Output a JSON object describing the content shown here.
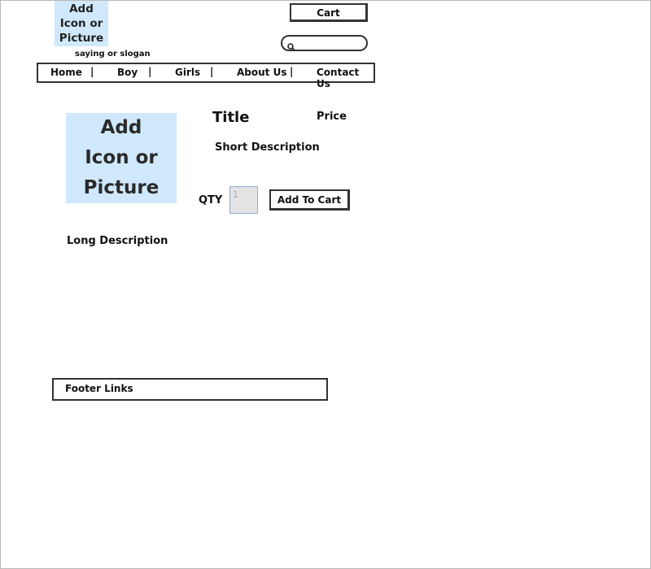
{
  "header": {
    "logo_lines": [
      "Add",
      "Icon or",
      "Picture"
    ],
    "slogan": "saying or slogan",
    "cart_label": "Cart",
    "search_placeholder": ""
  },
  "nav": {
    "items": [
      "Home",
      "Boy",
      "Girls",
      "About Us",
      "Contact Us"
    ],
    "separator": "|"
  },
  "product": {
    "image_lines": [
      "Add",
      "Icon or",
      "Picture"
    ],
    "title": "Title",
    "price": "Price",
    "short_description": "Short Description",
    "qty_label": "QTY",
    "qty_value": "1",
    "add_to_cart_label": "Add To Cart",
    "long_description": "Long Description"
  },
  "footer": {
    "links_label": "Footer Links"
  }
}
